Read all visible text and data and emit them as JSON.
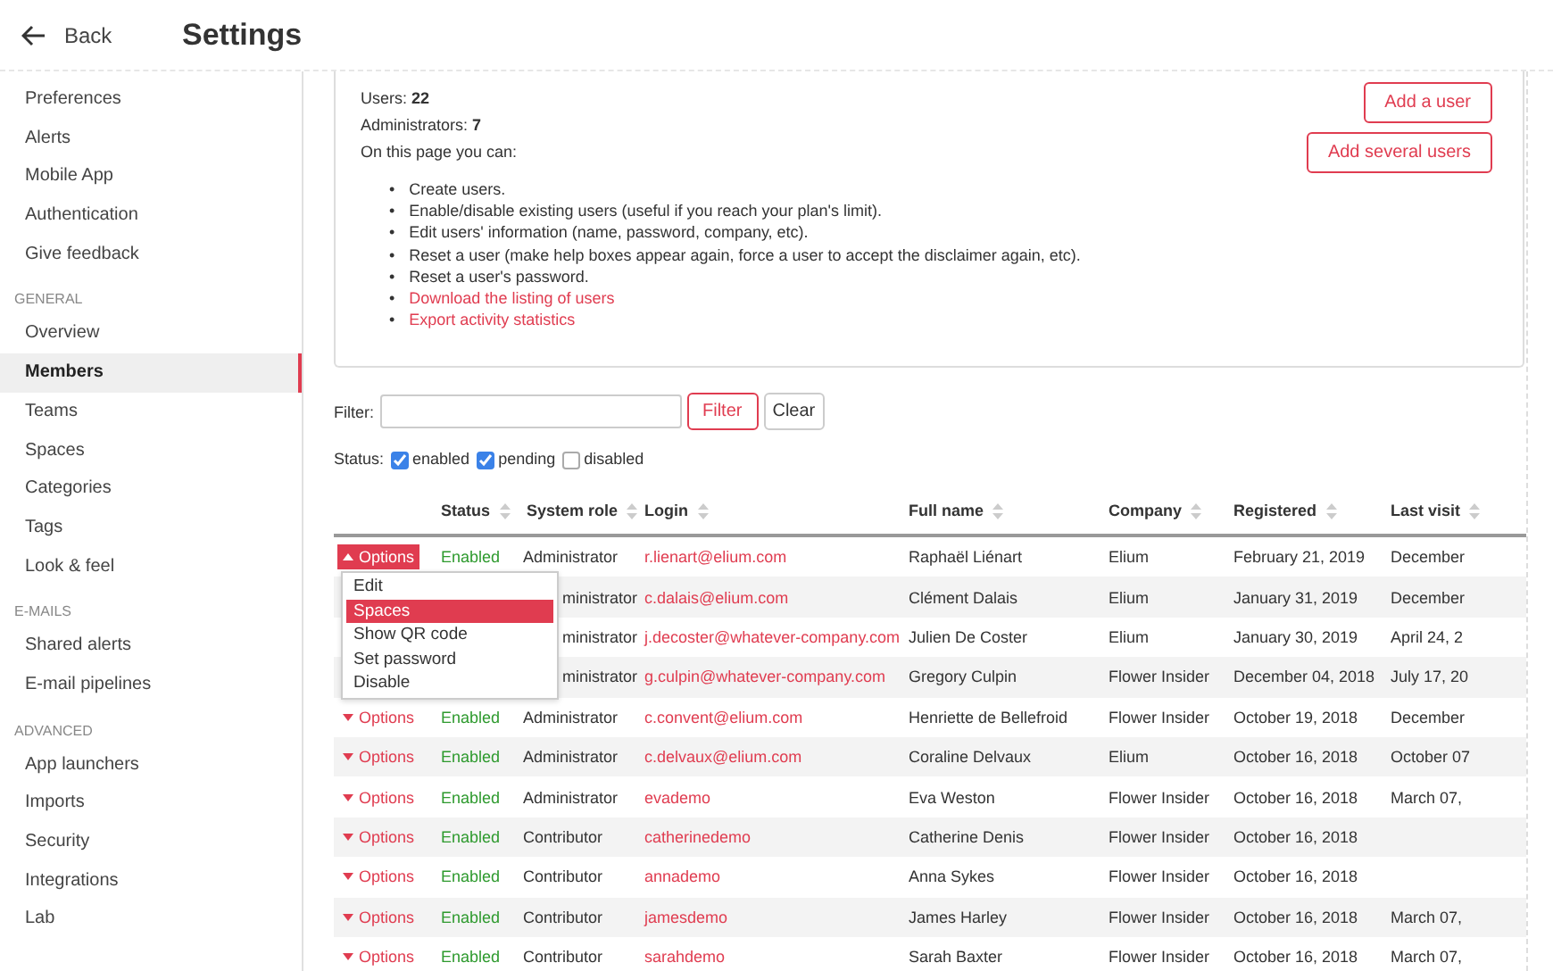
{
  "header": {
    "back": "Back",
    "title": "Settings"
  },
  "sidebar": {
    "items": [
      {
        "label": "Preferences",
        "kind": "item",
        "selected": false
      },
      {
        "label": "Alerts",
        "kind": "item",
        "selected": false
      },
      {
        "label": "Mobile App",
        "kind": "item",
        "selected": false
      },
      {
        "label": "Authentication",
        "kind": "item",
        "selected": false
      },
      {
        "label": "Give feedback",
        "kind": "item",
        "selected": false
      },
      {
        "label": "GENERAL",
        "kind": "heading"
      },
      {
        "label": "Overview",
        "kind": "item",
        "selected": false
      },
      {
        "label": "Members",
        "kind": "item",
        "selected": true
      },
      {
        "label": "Teams",
        "kind": "item",
        "selected": false
      },
      {
        "label": "Spaces",
        "kind": "item",
        "selected": false
      },
      {
        "label": "Categories",
        "kind": "item",
        "selected": false
      },
      {
        "label": "Tags",
        "kind": "item",
        "selected": false
      },
      {
        "label": "Look & feel",
        "kind": "item",
        "selected": false
      },
      {
        "label": "E-MAILS",
        "kind": "heading"
      },
      {
        "label": "Shared alerts",
        "kind": "item",
        "selected": false
      },
      {
        "label": "E-mail pipelines",
        "kind": "item",
        "selected": false
      },
      {
        "label": "ADVANCED",
        "kind": "heading"
      },
      {
        "label": "App launchers",
        "kind": "item",
        "selected": false
      },
      {
        "label": "Imports",
        "kind": "item",
        "selected": false
      },
      {
        "label": "Security",
        "kind": "item",
        "selected": false
      },
      {
        "label": "Integrations",
        "kind": "item",
        "selected": false
      },
      {
        "label": "Lab",
        "kind": "item",
        "selected": false
      }
    ]
  },
  "info": {
    "lines": [
      "Users: **22**",
      "Administrators: **7**",
      "On this page you can:"
    ],
    "bullet": "•",
    "bullets": [
      {
        "text": "Create users.",
        "kind": "text"
      },
      {
        "text": "Enable/disable existing users (useful if you reach your plan's limit).",
        "kind": "text"
      },
      {
        "text": "Edit users' information (name, password, company, etc).",
        "kind": "text"
      },
      {
        "text": "Reset a user (make help boxes appear again, force a user to accept the disclaimer again, etc).",
        "kind": "text"
      },
      {
        "text": "Reset a user's password.",
        "kind": "text"
      },
      {
        "text": "Download the listing of users",
        "kind": "link"
      },
      {
        "text": "Export activity statistics",
        "kind": "link"
      }
    ],
    "buttons": [
      "Add a user",
      "Add several users"
    ]
  },
  "filter": {
    "label": "Filter:",
    "button": "Filter",
    "clear": "Clear"
  },
  "status_filter": {
    "label": "Status:",
    "options": [
      {
        "label": "enabled",
        "checked": true
      },
      {
        "label": "pending",
        "checked": true
      },
      {
        "label": "disabled",
        "checked": false
      }
    ]
  },
  "table": {
    "columns": [
      "Status",
      "System role",
      "Login",
      "Full name",
      "Company",
      "Registered",
      "Last visit"
    ],
    "rows": [
      {
        "options": "Options",
        "open": true,
        "status": "Enabled",
        "role": "Administrator",
        "login": "r.lienart@elium.com",
        "full_name": "Raphaël Liénart",
        "company": "Elium",
        "registered": "February 21, 2019",
        "last_visit": "December"
      },
      {
        "role": "ministrator",
        "login": "c.dalais@elium.com",
        "full_name": "Clément Dalais",
        "company": "Elium",
        "registered": "January 31, 2019",
        "last_visit": "December"
      },
      {
        "role": "ministrator",
        "login": "j.decoster@whatever-company.com",
        "full_name": "Julien De Coster",
        "company": "Elium",
        "registered": "January 30, 2019",
        "last_visit": "April 24, 2"
      },
      {
        "role": "ministrator",
        "login": "g.culpin@whatever-company.com",
        "full_name": "Gregory Culpin",
        "company": "Flower Insider",
        "registered": "December 04, 2018",
        "last_visit": "July 17, 20"
      },
      {
        "options": "Options",
        "open": false,
        "status": "Enabled",
        "role": "Administrator",
        "login": "c.convent@elium.com",
        "full_name": "Henriette de Bellefroid",
        "company": "Flower Insider",
        "registered": "October 19, 2018",
        "last_visit": "December"
      },
      {
        "options": "Options",
        "open": false,
        "status": "Enabled",
        "role": "Administrator",
        "login": "c.delvaux@elium.com",
        "full_name": "Coraline Delvaux",
        "company": "Elium",
        "registered": "October 16, 2018",
        "last_visit": "October 07"
      },
      {
        "options": "Options",
        "open": false,
        "status": "Enabled",
        "role": "Administrator",
        "login": "evademo",
        "full_name": "Eva Weston",
        "company": "Flower Insider",
        "registered": "October 16, 2018",
        "last_visit": "March 07,"
      },
      {
        "options": "Options",
        "open": false,
        "status": "Enabled",
        "role": "Contributor",
        "login": "catherinedemo",
        "full_name": "Catherine Denis",
        "company": "Flower Insider",
        "registered": "October 16, 2018"
      },
      {
        "options": "Options",
        "open": false,
        "status": "Enabled",
        "role": "Contributor",
        "login": "annademo",
        "full_name": "Anna Sykes",
        "company": "Flower Insider",
        "registered": "October 16, 2018"
      },
      {
        "options": "Options",
        "open": false,
        "status": "Enabled",
        "role": "Contributor",
        "login": "jamesdemo",
        "full_name": "James Harley",
        "company": "Flower Insider",
        "registered": "October 16, 2018",
        "last_visit": "March 07,"
      },
      {
        "options": "Options",
        "open": false,
        "status": "Enabled",
        "role": "Contributor",
        "login": "sarahdemo",
        "full_name": "Sarah Baxter",
        "company": "Flower Insider",
        "registered": "October 16, 2018",
        "last_visit": "March 07,"
      }
    ]
  },
  "options_menu": {
    "items": [
      {
        "label": "Edit",
        "selected": false
      },
      {
        "label": "Spaces",
        "selected": true
      },
      {
        "label": "Show QR code",
        "selected": false
      },
      {
        "label": "Set password",
        "selected": false
      },
      {
        "label": "Disable",
        "selected": false
      }
    ]
  }
}
